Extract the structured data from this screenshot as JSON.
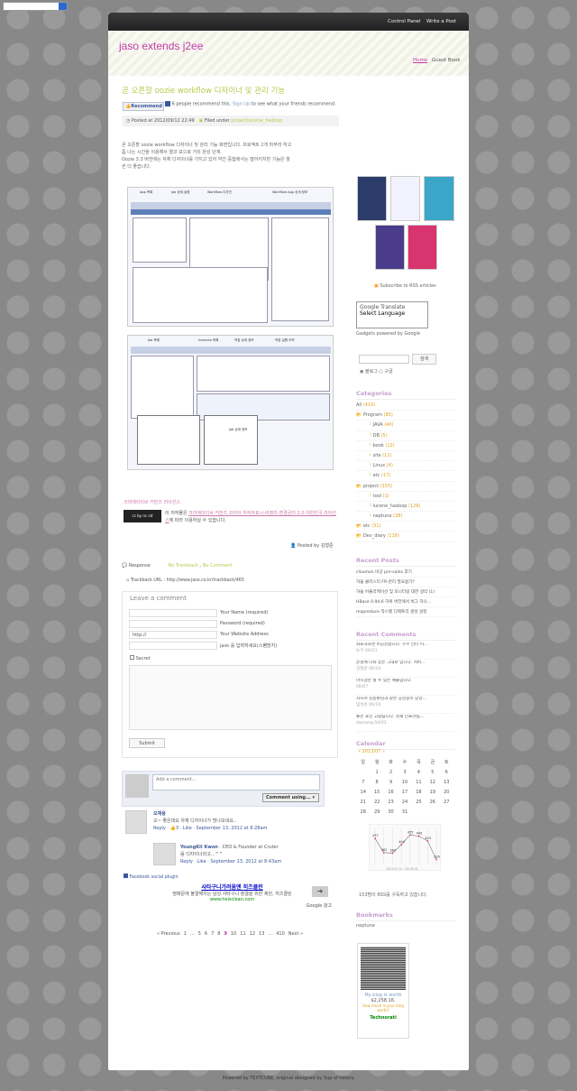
{
  "topbar": {
    "control_panel": "Control Panel",
    "write_post": "Write a Post"
  },
  "blog": {
    "title": "jaso extends j2ee"
  },
  "nav": {
    "home": "Home",
    "guestbook": "Guest Book"
  },
  "post": {
    "title": "곧 오픈할 oozie workflow 디자이너 및 관리 기능",
    "recommend_label": "Recommend",
    "recommend_count_text": "6 people recommend this.",
    "signup": "Sign Up",
    "recommend_tail": "to see what your friends recommend.",
    "posted_at": "Posted at 2012/09/12 22:49",
    "filed_under_label": "Filed under",
    "filed_under": "project/lucene_hadoop",
    "body_lines": [
      "곧 오픈할 oozie workflow 디자이너 및 관리 기능 화면입니다. 프로젝트 2개 마무리 하고",
      "좀 나는 시간을 이용해서 열코 모으로 거의 완성 단계.",
      "Oozie 3.3 버전에는 자체 디자이너를 가지고 있어 약간 중첩에서는 떨어지지만 기능은 월",
      "씬 더 좋습니다."
    ],
    "shot1_labels": [
      "App 목록",
      "Job 상세 설정",
      "Workflow 디자인",
      "Workflow App 상세 정보"
    ],
    "shot2_labels": [
      "Job 목록",
      "Job 상세 정보",
      "Instance 목록",
      "작업 상세 정보",
      "작업 실행 이력"
    ],
    "cc_title": "크리에이티브 커먼즈 라이선스",
    "cc_badge": "cc by nc nd",
    "cc_prefix": "이 저작물은",
    "cc_link": "크리에이티브 커먼즈 코리아 저작자표시-비영리-변경금지 2.0 대한민국 라이선스",
    "cc_suffix": "에 따라 이용하실 수 있습니다.",
    "posted_by": "Posted by 김형준"
  },
  "response": {
    "label": "Response",
    "trackback": "No Trackback",
    "comment": "No Comment",
    "trackback_url": "Trackback URL : http://www.jaso.co.kr/trackback/465"
  },
  "leave": {
    "title": "Leave a comment",
    "name": "Your Name (required)",
    "password": "Password (required)",
    "website_value": "http://",
    "website": "Your Website Address",
    "captcha": "jaso 를 입력하세요(스팸방지)",
    "secret": "Secret",
    "submit": "Submit"
  },
  "fb": {
    "placeholder": "Add a comment...",
    "post_as": "Comment using...",
    "c1_name": "오재용",
    "c1_text": "오~ 좋은데요 자체 디자이너가 멋나보네요..",
    "c1_meta": "Reply · 👍3 · Like · September 13, 2012 at 8:28am",
    "c2_name": "YoungKil Kwon",
    "c2_role": "· CEO & Founder at Cruter",
    "c2_text": "음 디자이너라고...^^",
    "c2_meta": "Reply · Like · September 13, 2012 at 8:43am",
    "plugin": "Facebook social plugin"
  },
  "ad": {
    "title": "사타구니가려움엔 히즈클린",
    "desc": "땀때문에 불결해지는 남성 사타구니 청결을 위한 제안, 히즈클린",
    "url": "www.heisclean.com",
    "google": "Google 광고"
  },
  "pager": {
    "items": [
      "« Previous",
      "1",
      "...",
      "5",
      "6",
      "7",
      "8",
      "9",
      "10",
      "11",
      "12",
      "13",
      "...",
      "410",
      "Next »"
    ]
  },
  "sidebar": {
    "rss": "Subscribe to RSS articles",
    "translate_brand": "Google Translate",
    "translate_select": "Select Language",
    "gadgets": "Gadgets powered by Google",
    "search_btn": "검색",
    "radio1": "블로그",
    "radio2": "구글",
    "categories_title": "Categories",
    "categories": [
      {
        "name": "All",
        "count": "(410)",
        "level": 0
      },
      {
        "name": "Program",
        "count": "(85)",
        "level": 0
      },
      {
        "name": "JAVA",
        "count": "(40)",
        "level": 1
      },
      {
        "name": "DB",
        "count": "(5)",
        "level": 1
      },
      {
        "name": "book",
        "count": "(12)",
        "level": 1
      },
      {
        "name": "site",
        "count": "(11)",
        "level": 1
      },
      {
        "name": "Linux",
        "count": "(4)",
        "level": 1
      },
      {
        "name": "etc",
        "count": "(17)",
        "level": 1
      },
      {
        "name": "project",
        "count": "(155)",
        "level": 0
      },
      {
        "name": "tool",
        "count": "(1)",
        "level": 1
      },
      {
        "name": "lucene_hadoop",
        "count": "(126)",
        "level": 1
      },
      {
        "name": "neptune",
        "count": "(28)",
        "level": 1
      },
      {
        "name": "etc",
        "count": "(31)",
        "level": 0
      },
      {
        "name": "Dev_diary",
        "count": "(118)",
        "level": 0
      }
    ],
    "recent_posts_title": "Recent Posts",
    "recent_posts": [
      "cloumon 비공 pre-sales 후기",
      "하둡 클러스터 FR-관리 필요없기?",
      "하둡 어플리케이션 및 모니터링 대한 생각 (1)",
      "HBase 0.94.6 하위 버전에서 버그 하나...",
      "mapreduce 작스별 디렉토리 생성 설정"
    ],
    "recent_comments_title": "Recent Comments",
    "recent_comments": [
      {
        "t": "좌표하자면 비공감합니다. 꾸꾸 인터 이...",
        "m": "뉴꾸 06/23"
      },
      {
        "t": "운영에 나와 있는 그대로 입니다. 서버...",
        "m": "김형준 06/10"
      },
      {
        "t": "아시겠만 될 수 있는 예물입니다.",
        "m": "06/07"
      },
      {
        "t": "저자서 김동환님과 같은 공감중이 있었...",
        "m": "임성준 06/10"
      },
      {
        "t": "좋은 포인 고맙습니다. 현재 인프라팀...",
        "m": "damang 04/03"
      }
    ],
    "calendar_title": "Calendar",
    "calendar_nav": "« 2013/07 »",
    "calendar_head": [
      "일",
      "월",
      "화",
      "수",
      "목",
      "금",
      "토"
    ],
    "calendar_rows": [
      [
        "",
        "1",
        "2",
        "3",
        "4",
        "5",
        "6"
      ],
      [
        "7",
        "8",
        "9",
        "10",
        "11",
        "12",
        "13"
      ],
      [
        "14",
        "15",
        "16",
        "17",
        "18",
        "19",
        "20"
      ],
      [
        "21",
        "22",
        "23",
        "24",
        "25",
        "26",
        "27"
      ],
      [
        "28",
        "29",
        "30",
        "31",
        "",
        "",
        ""
      ]
    ],
    "visitors": {
      "values": [
        437,
        362,
        360,
        404,
        455,
        449,
        424,
        326
      ],
      "labels": [
        "437",
        "362",
        "360",
        "404",
        "455",
        "449",
        "424",
        "326"
      ],
      "dates": "2013.07.12 - 09.09.05"
    },
    "rss_count": "153명이 RSS를 구독하고 있습니다.",
    "bookmarks_title": "Bookmarks",
    "bookmarks": [
      "neptune"
    ],
    "techno": {
      "line1": "My blog is worth",
      "value": "$2,258.16.",
      "link": "How much is your blog worth?",
      "brand": "Technorati"
    }
  },
  "footer": {
    "text": "Powered by TEXTCUBE, original designed by Sup of tistory."
  }
}
